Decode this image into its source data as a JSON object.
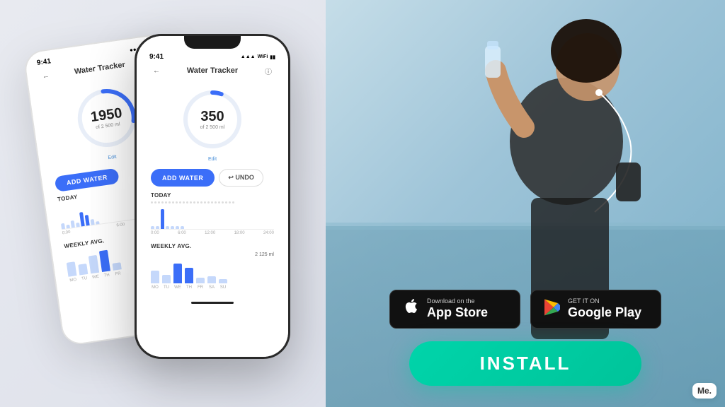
{
  "left": {
    "phone_bg": {
      "status_time": "9:41",
      "title": "Water Tracker",
      "value": "1950",
      "sub": "of 2 500 ml",
      "edit": "Edit",
      "add_water": "ADD WATER",
      "today_label": "TODAY",
      "weekly_label": "WEEKLY AVG."
    },
    "phone_fg": {
      "status_time": "9:41",
      "title": "Water Tracker",
      "value": "350",
      "sub": "of 2 500 ml",
      "edit": "Edit",
      "add_water": "ADD WATER",
      "undo": "↩ UNDO",
      "today_label": "TODAY",
      "weekly_label": "WEEKLY AVG.",
      "weekly_amount": "2 125 ml",
      "chart_labels": [
        "0:00",
        "6:00",
        "12:00",
        "18:00",
        "24:00"
      ],
      "week_labels": [
        "MO",
        "TU",
        "WE",
        "TH",
        "FR",
        "SA",
        "SU"
      ]
    }
  },
  "right": {
    "app_store": {
      "sub": "Download on the",
      "main": "App Store"
    },
    "google_play": {
      "sub": "GET IT ON",
      "main": "Google Play"
    },
    "install_label": "INSTALL",
    "me_logo": "Me."
  }
}
